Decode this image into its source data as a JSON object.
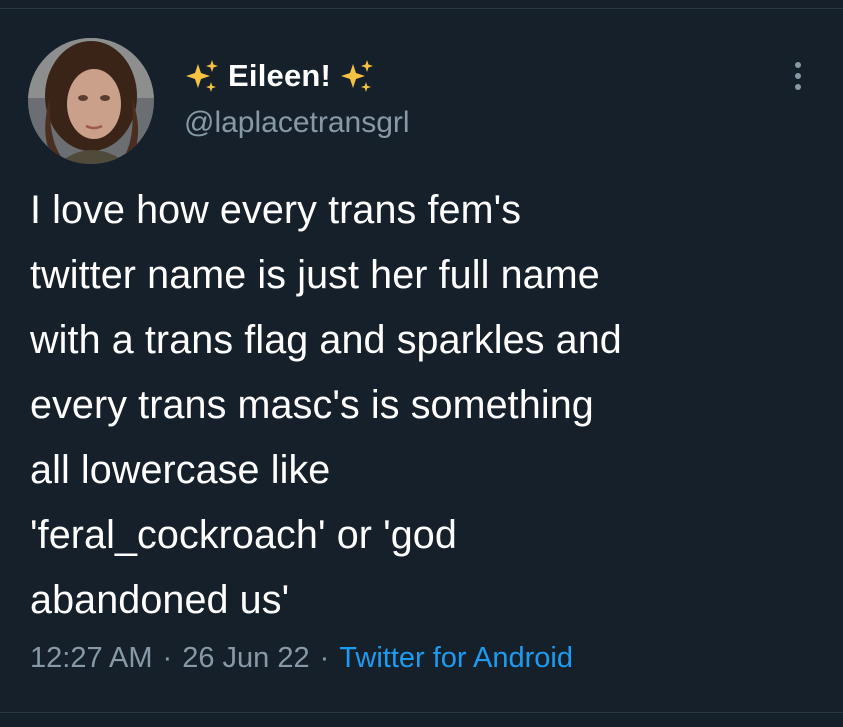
{
  "tweet": {
    "author": {
      "display_name": "Eileen!",
      "handle": "@laplacetransgrl",
      "name_icons": [
        "sparkles-icon",
        "sparkles-icon"
      ],
      "avatar": "avatar"
    },
    "text": "I love how every trans fem's\ntwitter name is just her full name\nwith a trans flag and sparkles and\nevery trans masc's is something\nall lowercase like\n'feral_cockroach' or 'god\nabandoned us'",
    "meta": {
      "time": "12:27 AM",
      "date": "26 Jun 22",
      "separator": "·",
      "source": "Twitter for Android"
    },
    "more_icon": "more-vertical-icon"
  },
  "colors": {
    "background": "#15202b",
    "text": "#ffffff",
    "secondary_text": "#8899a6",
    "link": "#1d9bf0",
    "sparkle": "#f5c242"
  }
}
